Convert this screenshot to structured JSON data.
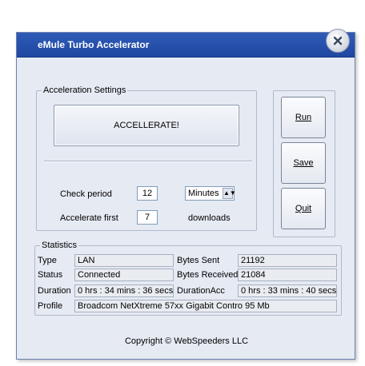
{
  "window": {
    "title": "eMule Turbo Accelerator"
  },
  "acceleration": {
    "group_label": "Acceleration Settings",
    "accelerate_button": "ACCELLERATE!",
    "check_period_label": "Check period",
    "check_period_value": "12",
    "period_unit": "Minutes",
    "accelerate_first_label": "Accelerate first",
    "accelerate_first_value": "7",
    "downloads_label": "downloads"
  },
  "buttons": {
    "run": "Run",
    "save": "Save",
    "quit": "Quit"
  },
  "statistics": {
    "group_label": "Statistics",
    "type_label": "Type",
    "type_value": "LAN",
    "status_label": "Status",
    "status_value": "Connected",
    "duration_label": "Duration",
    "duration_value": "0 hrs : 34 mins : 36 secs",
    "profile_label": "Profile",
    "profile_value": "Broadcom NetXtreme 57xx Gigabit Contro 95 Mb",
    "bytes_sent_label": "Bytes Sent",
    "bytes_sent_value": "21192",
    "bytes_received_label": "Bytes Received",
    "bytes_received_value": "21084",
    "duration_acc_label": "DurationAcc",
    "duration_acc_value": "0 hrs : 33 mins : 40 secs"
  },
  "footer": {
    "copyright": "Copyright © WebSpeeders LLC"
  },
  "colors": {
    "titlebar": "#2e5bb7",
    "window_bg": "#e6eaf3",
    "border": "#6c7fae"
  }
}
